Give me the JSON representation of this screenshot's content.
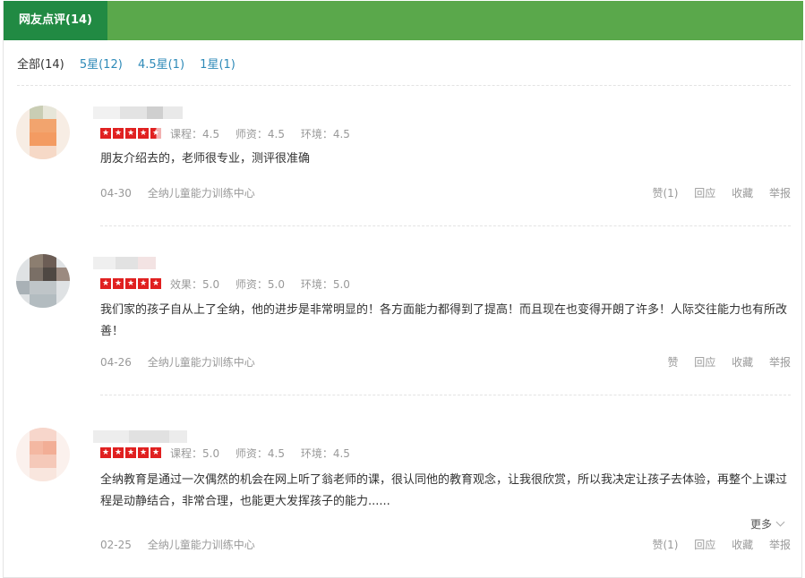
{
  "header": {
    "tab_label": "网友点评(14)"
  },
  "filters": [
    {
      "label": "全部(14)"
    },
    {
      "label": "5星(12)"
    },
    {
      "label": "4.5星(1)"
    },
    {
      "label": "1星(1)"
    }
  ],
  "reviews": [
    {
      "rating": 4.5,
      "scores": [
        "课程：4.5",
        "师资：4.5",
        "环境：4.5"
      ],
      "content": "朋友介绍去的，老师很专业，测评很准确",
      "date": "04-30",
      "school": "全纳儿童能力训练中心",
      "actions": {
        "like": "赞(1)",
        "reply": "回应",
        "favorite": "收藏",
        "report": "举报"
      }
    },
    {
      "rating": 5,
      "scores": [
        "效果：5.0",
        "师资：5.0",
        "环境：5.0"
      ],
      "content": "我们家的孩子自从上了全纳，他的进步是非常明显的！各方面能力都得到了提高！而且现在也变得开朗了许多！人际交往能力也有所改善！",
      "date": "04-26",
      "school": "全纳儿童能力训练中心",
      "actions": {
        "like": "赞",
        "reply": "回应",
        "favorite": "收藏",
        "report": "举报"
      }
    },
    {
      "rating": 5,
      "scores": [
        "课程：5.0",
        "师资：4.5",
        "环境：4.5"
      ],
      "content": "全纳教育是通过一次偶然的机会在网上听了翁老师的课，很认同他的教育观念，让我很欣赏，所以我决定让孩子去体验，再整个上课过程是动静结合，非常合理，也能更大发挥孩子的能力......",
      "more": "更多",
      "date": "02-25",
      "school": "全纳儿童能力训练中心",
      "actions": {
        "like": "赞(1)",
        "reply": "回应",
        "favorite": "收藏",
        "report": "举报"
      }
    }
  ]
}
